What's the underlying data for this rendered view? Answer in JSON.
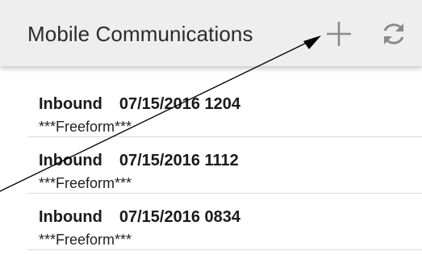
{
  "header": {
    "title": "Mobile Communications",
    "add_icon": "plus-icon",
    "refresh_icon": "refresh-icon",
    "icon_color": "#8a8a8a"
  },
  "messages": [
    {
      "direction": "Inbound",
      "datetime": "07/15/2016 1204",
      "body": "***Freeform***"
    },
    {
      "direction": "Inbound",
      "datetime": "07/15/2016 1112",
      "body": "***Freeform***"
    },
    {
      "direction": "Inbound",
      "datetime": "07/15/2016 0834",
      "body": "***Freeform***"
    }
  ],
  "annotation": {
    "type": "arrow",
    "color": "#000000",
    "points_to": "add-button"
  }
}
